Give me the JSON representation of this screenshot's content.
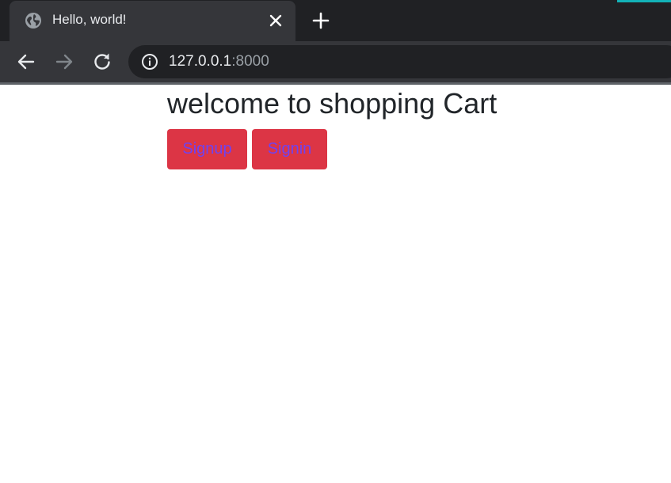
{
  "browser": {
    "tab": {
      "title": "Hello, world!"
    },
    "address": {
      "host": "127.0.0.1",
      "port": ":8000"
    },
    "icons": {
      "favicon": "globe-icon",
      "tab_close": "close-icon",
      "new_tab": "plus-icon",
      "back": "arrow-left-icon",
      "forward": "arrow-right-icon",
      "reload": "reload-icon",
      "site_info": "info-icon"
    },
    "colors": {
      "tabstrip": "#202124",
      "toolbar": "#35363a",
      "accent": "#13b2b8"
    }
  },
  "page": {
    "title": "welcome to shopping Cart",
    "buttons": {
      "signup_label": "Signup",
      "signin_label": "Signin"
    },
    "colors": {
      "button_background": "#dc3545",
      "button_text": "#6f42f0",
      "heading_text": "#212529"
    }
  }
}
